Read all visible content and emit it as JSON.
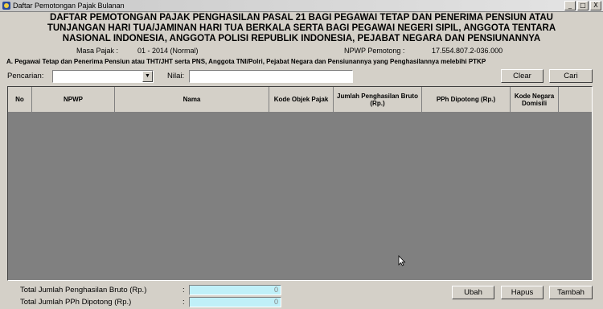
{
  "window": {
    "title": "Daftar Pemotongan Pajak Bulanan",
    "controls": [
      "_",
      "□",
      "X"
    ]
  },
  "header": {
    "title_line1": "DAFTAR PEMOTONGAN PAJAK PENGHASILAN PASAL 21 BAGI PEGAWAI TETAP DAN PENERIMA PENSIUN ATAU",
    "title_line2": "TUNJANGAN HARI TUA/JAMINAN HARI TUA BERKALA SERTA BAGI PEGAWAI NEGERI SIPIL, ANGGOTA TENTARA",
    "title_line3": "NASIONAL INDONESIA, ANGGOTA POLISI REPUBLIK INDONESIA, PEJABAT NEGARA DAN PENSIUNANNYA"
  },
  "info": {
    "masa_pajak_label": "Masa Pajak :",
    "masa_pajak_value": "01 - 2014 (Normal)",
    "npwp_label": "NPWP Pemotong :",
    "npwp_value": "17.554.807.2-036.000"
  },
  "section_label": "A. Pegawai Tetap dan Penerima Pensiun atau THT/JHT serta PNS, Anggota TNI/Polri, Pejabat Negara dan Pensiunannya yang Penghasilannya melebihi PTKP",
  "search": {
    "pencarian_label": "Pencarian:",
    "pencarian_value": "",
    "nilai_label": "Nilai:",
    "nilai_value": "",
    "clear_label": "Clear",
    "cari_label": "Cari"
  },
  "table": {
    "columns": [
      "No",
      "NPWP",
      "Nama",
      "Kode Objek Pajak",
      "Jumlah Penghasilan Bruto (Rp.)",
      "PPh Dipotong (Rp.)",
      "Kode Negara Domisili"
    ],
    "rows": []
  },
  "totals": {
    "bruto_label": "Total Jumlah Penghasilan Bruto (Rp.)",
    "bruto_value": "0",
    "pph_label": "Total Jumlah PPh Dipotong (Rp.)",
    "pph_value": "0",
    "colon": ":"
  },
  "actions": {
    "ubah_label": "Ubah",
    "hapus_label": "Hapus",
    "tambah_label": "Tambah"
  }
}
